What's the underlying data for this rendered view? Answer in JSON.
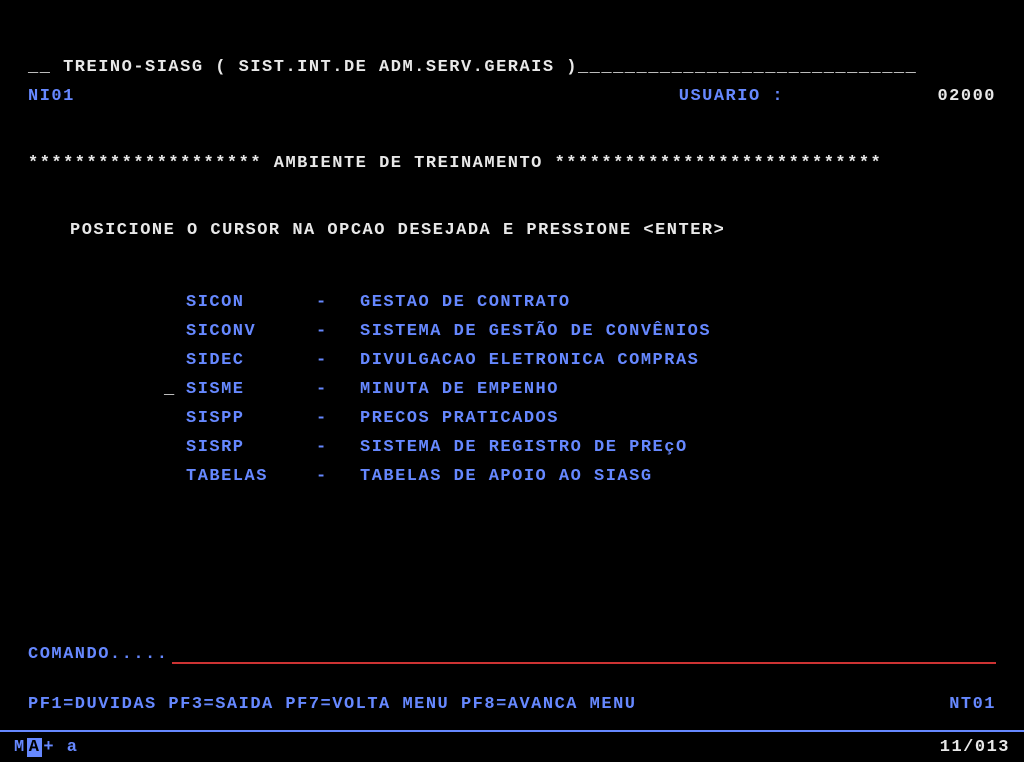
{
  "header": {
    "title_prefix": "__ ",
    "title": "TREINO-SIASG ( SIST.INT.DE ADM.SERV.GERAIS )",
    "title_suffix": "_____________________________",
    "screen_id": "NI01",
    "usuario_label": "USUARIO :",
    "usuario_value": "02000"
  },
  "banner": {
    "prefix": "******************** ",
    "text": "AMBIENTE DE TREINAMENTO",
    "suffix": " ****************************"
  },
  "instruction": "POSICIONE O CURSOR NA OPCAO DESEJADA E PRESSIONE <ENTER>",
  "cursor_index": 3,
  "cursor_symbol": "_",
  "menu": [
    {
      "code": "SICON",
      "desc": "GESTAO DE CONTRATO"
    },
    {
      "code": "SICONV",
      "desc": "SISTEMA DE GESTÃO DE CONVÊNIOS"
    },
    {
      "code": "SIDEC",
      "desc": "DIVULGACAO ELETRONICA COMPRAS"
    },
    {
      "code": "SISME",
      "desc": "MINUTA DE EMPENHO"
    },
    {
      "code": "SISPP",
      "desc": "PRECOS PRATICADOS"
    },
    {
      "code": "SISRP",
      "desc": "SISTEMA DE REGISTRO DE PREçO"
    },
    {
      "code": "TABELAS",
      "desc": "TABELAS DE APOIO AO SIASG"
    }
  ],
  "comando": {
    "label": "COMANDO.....",
    "value": ""
  },
  "pfkeys": {
    "text": "PF1=DUVIDAS PF3=SAIDA PF7=VOLTA MENU PF8=AVANCA MENU",
    "right": "NT01"
  },
  "status": {
    "left_prefix": "M",
    "left_cursor": "A",
    "left_suffix": " +  a",
    "position": "11/013"
  }
}
